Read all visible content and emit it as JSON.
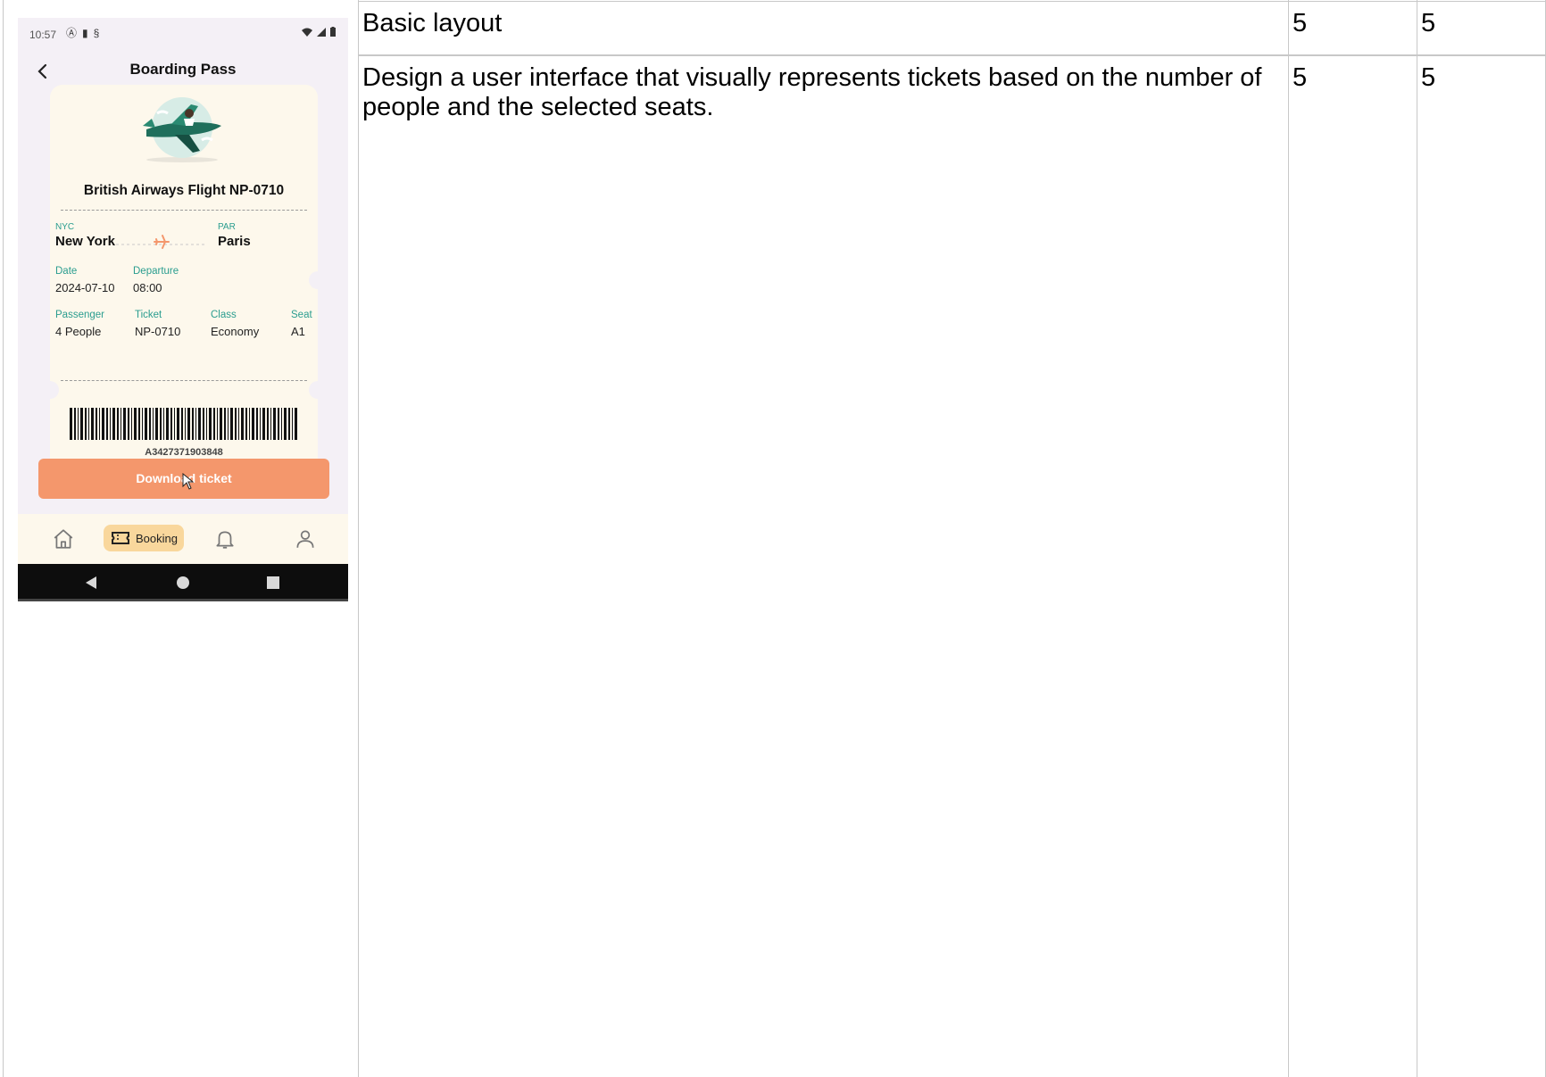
{
  "table": {
    "rows": [
      {
        "criterion": "Basic layout",
        "score_a": "5",
        "score_b": "5"
      },
      {
        "criterion": "Design a user interface that visually represents tickets based on the number of people and the selected seats.",
        "score_a": "5",
        "score_b": "5"
      }
    ]
  },
  "phone": {
    "status_time": "10:57",
    "app_title": "Boarding Pass",
    "flight_title": "British Airways Flight NP-0710",
    "origin": {
      "code": "NYC",
      "city": "New York"
    },
    "destination": {
      "code": "PAR",
      "city": "Paris"
    },
    "details": {
      "date_label": "Date",
      "date_value": "2024-07-10",
      "departure_label": "Departure",
      "departure_value": "08:00",
      "passenger_label": "Passenger",
      "passenger_value": "4 People",
      "ticket_label": "Ticket",
      "ticket_value": "NP-0710",
      "class_label": "Class",
      "class_value": "Economy",
      "seat_label": "Seat",
      "seat_value": "A1"
    },
    "barcode_number": "A3427371903848",
    "download_button": "Download ticket",
    "nav": {
      "active_label": "Booking"
    },
    "colors": {
      "accent": "#f4976c",
      "teal": "#2a9d8f",
      "pill": "#f9d79c",
      "ticket_bg": "#fdf8ec"
    }
  }
}
